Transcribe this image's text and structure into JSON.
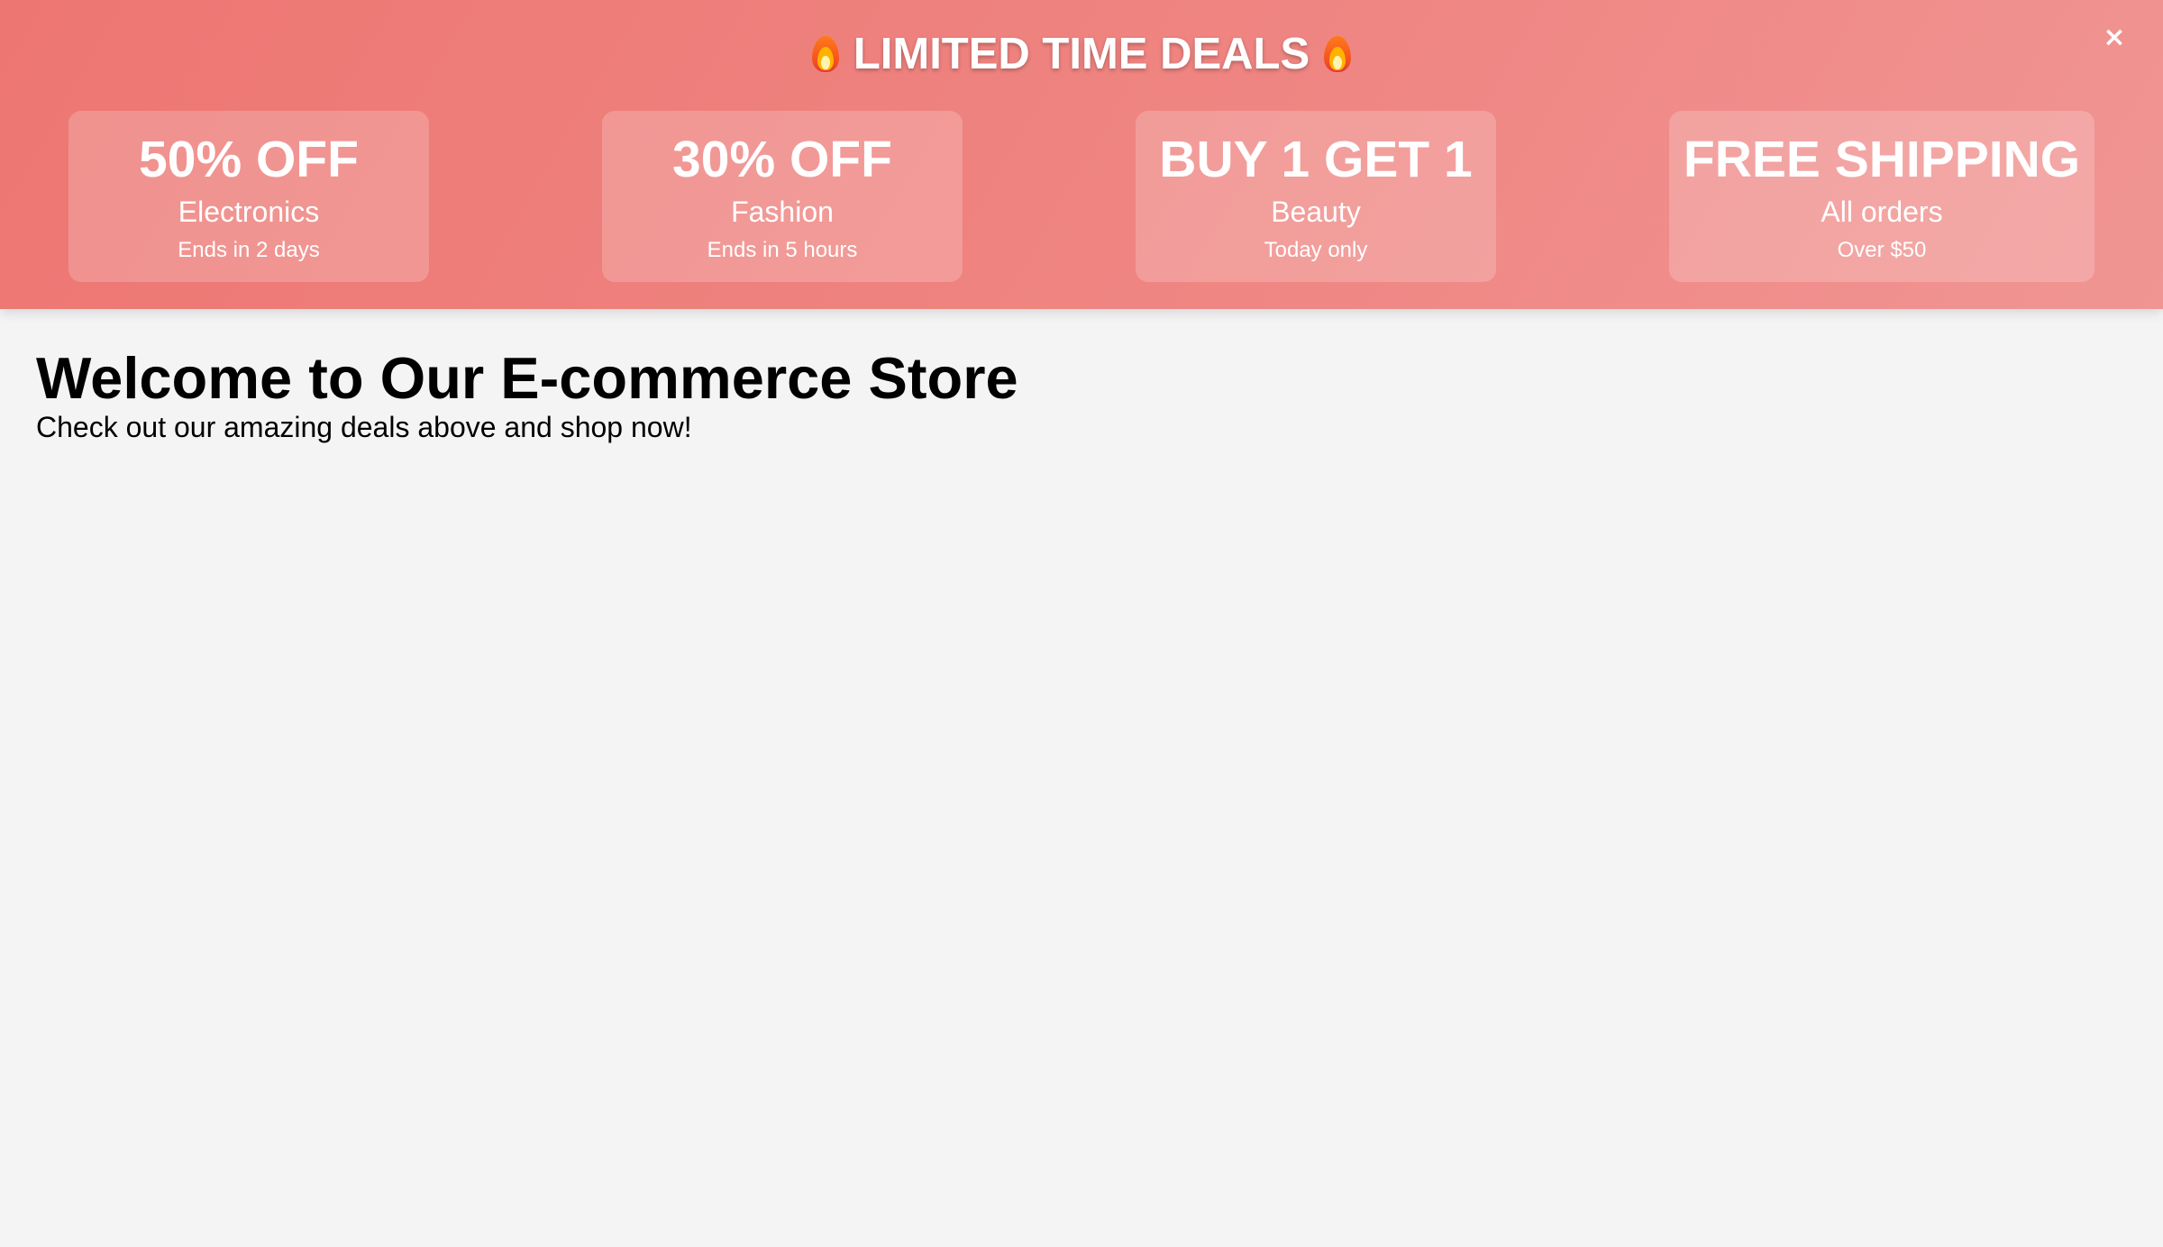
{
  "banner": {
    "title": "LIMITED TIME DEALS",
    "title_icon": "fire-icon",
    "close_label": "×",
    "colors": {
      "gradient_start": "#ed7672",
      "gradient_end": "#f09593",
      "text": "#ffffff"
    },
    "deals": [
      {
        "headline": "50% OFF",
        "category": "Electronics",
        "note": "Ends in 2 days"
      },
      {
        "headline": "30% OFF",
        "category": "Fashion",
        "note": "Ends in 5 hours"
      },
      {
        "headline": "BUY 1 GET 1",
        "category": "Beauty",
        "note": "Today only"
      },
      {
        "headline": "FREE SHIPPING",
        "category": "All orders",
        "note": "Over $50"
      }
    ]
  },
  "main": {
    "title": "Welcome to Our E-commerce Store",
    "subtitle": "Check out our amazing deals above and shop now!",
    "background_color": "#f4f4f4"
  }
}
